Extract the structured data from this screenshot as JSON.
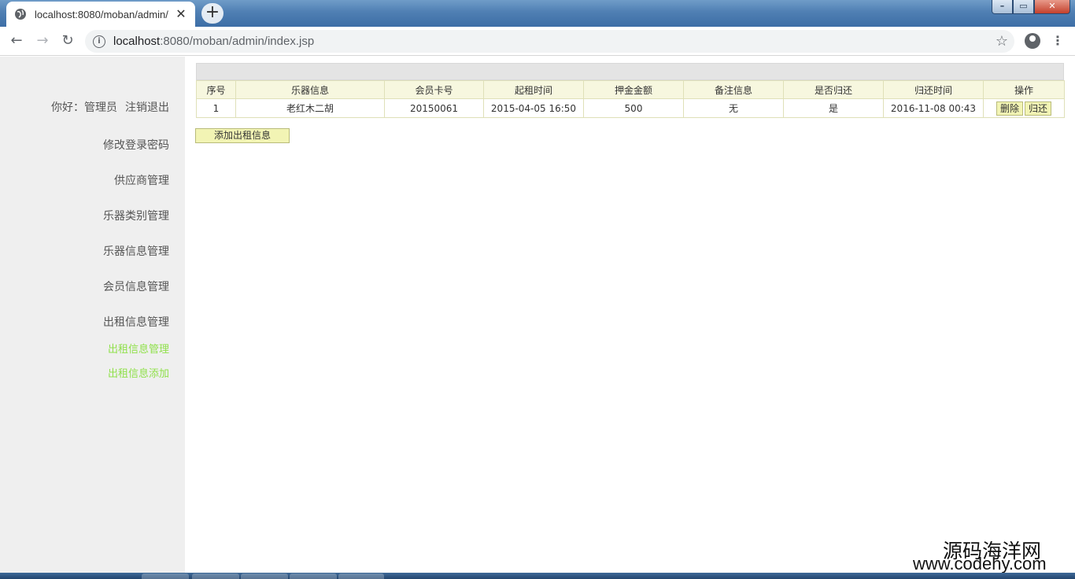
{
  "browser": {
    "tab_title": "localhost:8080/moban/admin/",
    "url_host": "localhost",
    "url_rest": ":8080/moban/admin/index.jsp",
    "newtab_label": "+",
    "tab_close": "✕",
    "win_min": "–",
    "win_max": "▭",
    "win_close": "✕",
    "back": "←",
    "forward": "→",
    "reload": "↻",
    "star": "☆",
    "menu": "⋮"
  },
  "sidebar": {
    "greeting": "你好：管理员",
    "logout": "注销退出",
    "items": [
      {
        "label": "修改登录密码"
      },
      {
        "label": "供应商管理"
      },
      {
        "label": "乐器类别管理"
      },
      {
        "label": "乐器信息管理"
      },
      {
        "label": "会员信息管理"
      },
      {
        "label": "出租信息管理"
      }
    ],
    "subitems": [
      {
        "label": "出租信息管理"
      },
      {
        "label": "出租信息添加"
      }
    ]
  },
  "table": {
    "headers": [
      "序号",
      "乐器信息",
      "会员卡号",
      "起租时间",
      "押金金额",
      "备注信息",
      "是否归还",
      "归还时间",
      "操作"
    ],
    "rows": [
      {
        "index": "1",
        "instrument": "老红木二胡",
        "member_card": "20150061",
        "start_time": "2015-04-05 16:50",
        "deposit": "500",
        "remark": "无",
        "returned": "是",
        "return_time": "2016-11-08 00:43",
        "delete_label": "删除",
        "return_label": "归还"
      }
    ]
  },
  "add_button": "添加出租信息",
  "watermark": {
    "line1": "源码海洋网",
    "line2": "www.codehy.com"
  },
  "colors": {
    "sidebar_bg": "#efefef",
    "sub_link": "#8fe04a",
    "header_bg": "#f7f7df",
    "button_bg": "#f2f4b4"
  }
}
